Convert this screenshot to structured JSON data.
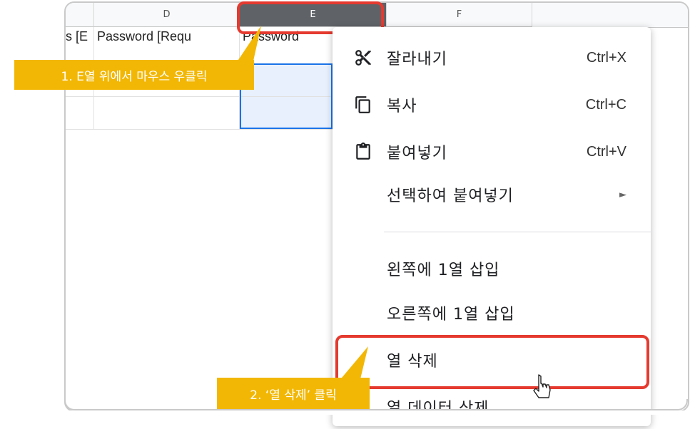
{
  "spreadsheet": {
    "columns": [
      "D",
      "E",
      "F"
    ],
    "selected_column": "E",
    "cells": {
      "c_row1": "s [E",
      "d_row1": "Password [Requ",
      "e_row1": "Password"
    }
  },
  "context_menu": {
    "items": [
      {
        "label": "잘라내기",
        "shortcut": "Ctrl+X",
        "icon": "scissors-icon"
      },
      {
        "label": "복사",
        "shortcut": "Ctrl+C",
        "icon": "copy-icon"
      },
      {
        "label": "붙여넣기",
        "shortcut": "Ctrl+V",
        "icon": "clipboard-icon"
      },
      {
        "label": "선택하여 붙여넣기",
        "arrow": "►"
      },
      {
        "label": "왼쪽에 1열 삽입"
      },
      {
        "label": "오른쪽에 1열 삽입"
      },
      {
        "label": "열 삭제"
      },
      {
        "label": "열 데이터 삭제"
      }
    ]
  },
  "callouts": {
    "step1": "1. E열 위에서 마우스 우클릭",
    "step2": "2. ‘열 삭제’ 클릭"
  },
  "colors": {
    "highlight": "#e53a2f",
    "callout": "#f2b705",
    "selected_header": "#5f6368",
    "selection_border": "#1a73e8"
  }
}
